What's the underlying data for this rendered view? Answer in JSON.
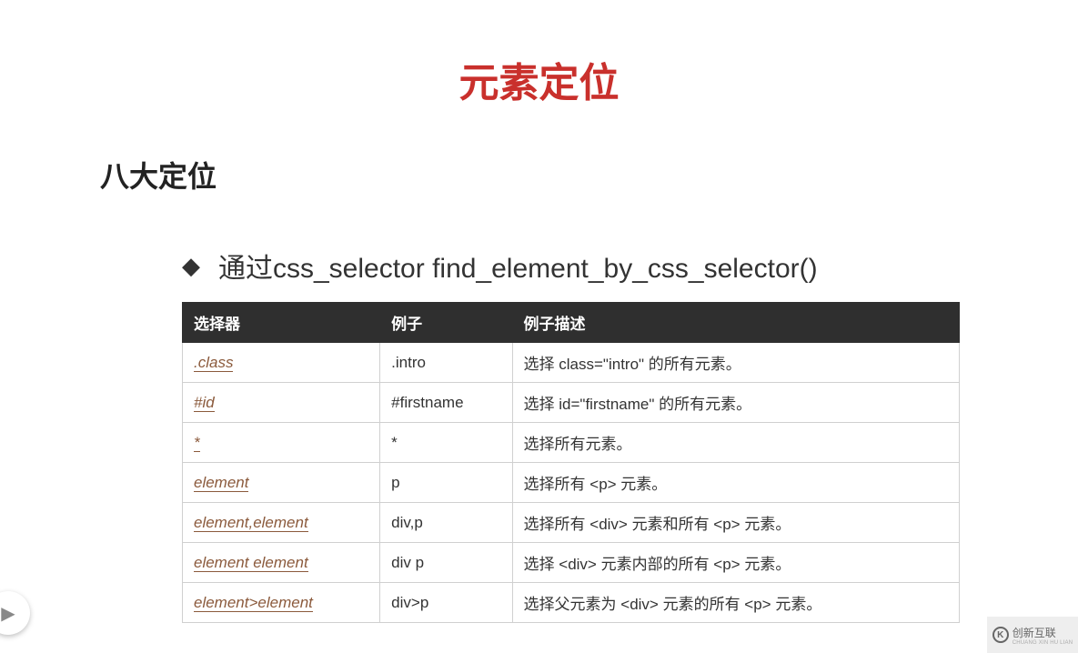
{
  "title": "元素定位",
  "subtitle": "八大定位",
  "bullet": {
    "prefix": "◆",
    "text": "通过css_selector  find_element_by_css_selector()"
  },
  "table": {
    "headers": [
      "选择器",
      "例子",
      "例子描述"
    ],
    "rows": [
      {
        "selector": ".class",
        "example": ".intro",
        "desc": "选择 class=\"intro\" 的所有元素。"
      },
      {
        "selector": "#id",
        "example": "#firstname",
        "desc": "选择 id=\"firstname\" 的所有元素。"
      },
      {
        "selector": "*",
        "example": "*",
        "desc": "选择所有元素。"
      },
      {
        "selector": "element",
        "example": "p",
        "desc": "选择所有 <p> 元素。"
      },
      {
        "selector": "element,element",
        "example": "div,p",
        "desc": "选择所有 <div> 元素和所有 <p> 元素。"
      },
      {
        "selector": "element element",
        "example": "div p",
        "desc": "选择 <div> 元素内部的所有 <p> 元素。"
      },
      {
        "selector": "element>element",
        "example": "div>p",
        "desc": "选择父元素为 <div> 元素的所有 <p> 元素。"
      }
    ]
  },
  "nav_arrow": "▶",
  "watermark": {
    "main": "创新互联",
    "sub": "CHUANG XIN HU LIAN"
  }
}
